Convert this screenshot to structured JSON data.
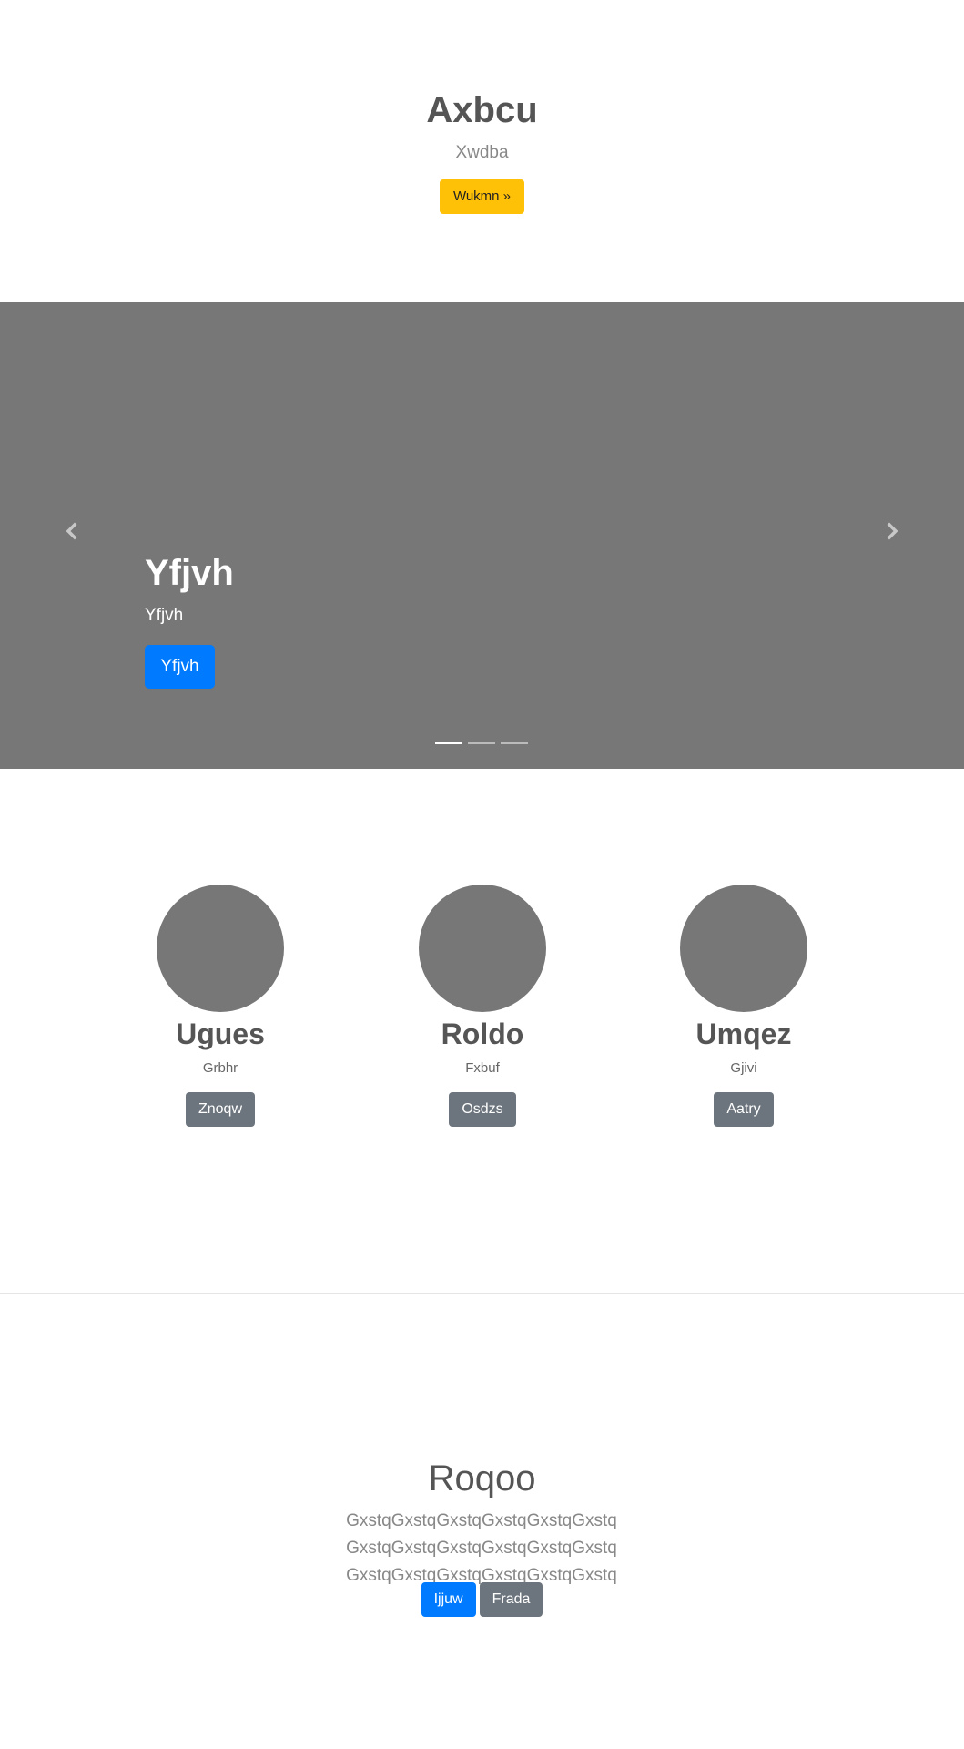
{
  "hero": {
    "title": "Axbcu",
    "subtitle": "Xwdba",
    "button_label": "Wukmn »"
  },
  "carousel": {
    "prev_icon": "chevron-left-icon",
    "next_icon": "chevron-right-icon",
    "caption_title": "Yfjvh",
    "caption_subtitle": "Yfjvh",
    "caption_button": "Yfjvh",
    "active_slide": 1,
    "slide_count": 3
  },
  "team": [
    {
      "name": "Ugues",
      "role": "Grbhr",
      "button": "Znoqw"
    },
    {
      "name": "Roldo",
      "role": "Fxbuf",
      "button": "Osdzs"
    },
    {
      "name": "Umqez",
      "role": "Gjivi",
      "button": "Aatry"
    }
  ],
  "cta": {
    "title": "Roqoo",
    "text": "GxstqGxstqGxstqGxstqGxstqGxstq GxstqGxstqGxstqGxstqGxstqGxstq GxstqGxstqGxstqGxstqGxstqGxstq",
    "primary_button": "Ijjuw",
    "secondary_button": "Frada"
  },
  "colors": {
    "warning": "#ffc107",
    "primary": "#007bff",
    "secondary": "#6c757d",
    "placeholder_gray": "#777777"
  }
}
